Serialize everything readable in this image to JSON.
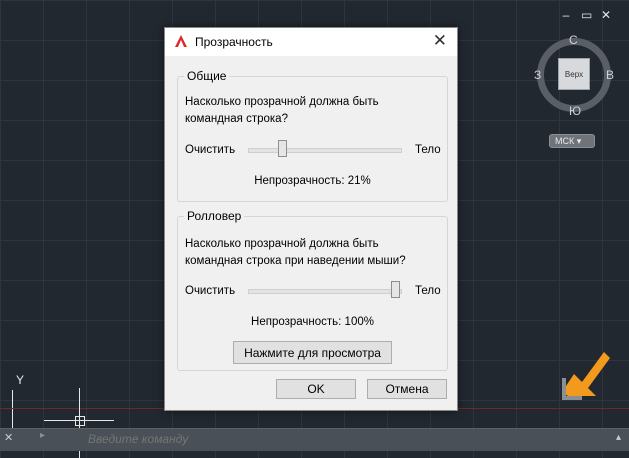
{
  "window": {
    "controls": [
      "–",
      "▭",
      "✕"
    ]
  },
  "viewcube": {
    "north": "С",
    "south": "Ю",
    "west": "З",
    "east": "В",
    "face": "Верх",
    "ucs": "МСК ▾"
  },
  "axis": {
    "y_label": "Y"
  },
  "command_line": {
    "close": "✕",
    "arrow": "▸",
    "placeholder": "Введите команду",
    "caret": "▴"
  },
  "dialog": {
    "title": "Прозрачность",
    "close": "✕",
    "general": {
      "title": "Общие",
      "question": "Насколько прозрачной должна быть командная строка?",
      "left": "Очистить",
      "right": "Тело",
      "opacity_text": "Непрозрачность:  21%",
      "value": 21
    },
    "rollover": {
      "title": "Ролловер",
      "question": "Насколько прозрачной должна быть командная строка при наведении мыши?",
      "left": "Очистить",
      "right": "Тело",
      "opacity_text": "Непрозрачность: 100%",
      "value": 100,
      "preview_button": "Нажмите для просмотра"
    },
    "ok": "OK",
    "cancel": "Отмена"
  },
  "colors": {
    "accent_red": "#d92b2b",
    "logo_orange": "#f39a1e",
    "background": "#212830"
  }
}
